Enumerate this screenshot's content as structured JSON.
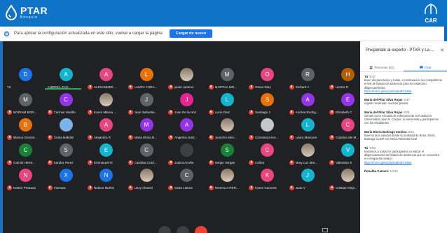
{
  "brand": {
    "name": "PTAR",
    "sub": "Bosquin",
    "right_logo": "CAR"
  },
  "notice": {
    "text": "Para aplicar la configuración actualizada en este sitio, vuelve a cargar la página",
    "button": "Cargar de nuevo"
  },
  "participants": [
    {
      "initial": "D",
      "color": "#1a73e8",
      "name": "Tú",
      "mic_off": false
    },
    {
      "initial": "A",
      "color": "#12b5cb",
      "name": "ANDREA PAO...",
      "mic_off": false
    },
    {
      "initial": "A",
      "color": "#e8467c",
      "name": "ALEXANDER ...",
      "mic_off": true
    },
    {
      "initial": "L",
      "color": "#e8710a",
      "name": "LAURA YURA...",
      "mic_off": true
    },
    {
      "initial": "",
      "color": "photo",
      "name": "javier ramirez",
      "mic_off": true
    },
    {
      "initial": "M",
      "color": "#5f6368",
      "name": "MARTHA MO...",
      "mic_off": true
    },
    {
      "initial": "O",
      "color": "#e8467c",
      "name": "Oscar Diaz",
      "mic_off": true
    },
    {
      "initial": "R",
      "color": "#5f6368",
      "name": "Richard A",
      "mic_off": true
    },
    {
      "initial": "H",
      "color": "#b06000",
      "name": "Hector R",
      "mic_off": true
    },
    {
      "initial": "M",
      "color": "#5f6368",
      "name": "MYRIAM BOR...",
      "mic_off": true
    },
    {
      "initial": "C",
      "color": "#9334e6",
      "name": "Carmen Murillo",
      "mic_off": true
    },
    {
      "initial": "",
      "color": "photo",
      "name": "Karen Milena ...",
      "mic_off": true
    },
    {
      "initial": "J",
      "color": "#5f6368",
      "name": "Juan Sebastia...",
      "mic_off": true
    },
    {
      "initial": "J",
      "color": "#e52592",
      "name": "Jose De la Hoz",
      "mic_off": true
    },
    {
      "initial": "L",
      "color": "#12b5cb",
      "name": "Lucio Diaz",
      "mic_off": true
    },
    {
      "initial": "S",
      "color": "#e8710a",
      "name": "Santiago J",
      "mic_off": true
    },
    {
      "initial": "A",
      "color": "#9334e6",
      "name": "Andrés Rodrig...",
      "mic_off": true
    },
    {
      "initial": "E",
      "color": "#9334e6",
      "name": "Elizabeth C",
      "mic_off": true
    },
    {
      "initial": "B",
      "color": "#e8710a",
      "name": "Blanca Gonzal...",
      "mic_off": true
    },
    {
      "initial": "",
      "color": "#7cb3e8",
      "name": "Gusta leididiel",
      "mic_off": true
    },
    {
      "initial": "A",
      "color": "#e8467c",
      "name": "Alejandra R",
      "mic_off": true
    },
    {
      "initial": "M",
      "color": "#9334e6",
      "name": "Maria Elvira B...",
      "mic_off": true
    },
    {
      "initial": "A",
      "color": "#9334e6",
      "name": "Angelica Garz...",
      "mic_off": true
    },
    {
      "initial": "",
      "color": "photo",
      "name": "Juancho Men...",
      "mic_off": true
    },
    {
      "initial": "",
      "color": "#c3c7cc",
      "name": "Constanza leo...",
      "mic_off": true
    },
    {
      "initial": "L",
      "color": "#12b5cb",
      "name": "Laura Mancera",
      "mic_off": true
    },
    {
      "initial": "C",
      "color": "#e8467c",
      "name": "Catalina del M...",
      "mic_off": true
    },
    {
      "initial": "C",
      "color": "#188038",
      "name": "Camilo Herra...",
      "mic_off": true
    },
    {
      "initial": "S",
      "color": "#5f6368",
      "name": "Sandra Perez",
      "mic_off": true
    },
    {
      "initial": "E",
      "color": "#12b5cb",
      "name": "Emmanuel N",
      "mic_off": true
    },
    {
      "initial": "C",
      "color": "#5f6368",
      "name": "Carolina Card...",
      "mic_off": true
    },
    {
      "initial": "",
      "color": "#3c4043",
      "name": "Josica Acuña",
      "mic_off": true
    },
    {
      "initial": "S",
      "color": "#188038",
      "name": "Sergio Vargas",
      "mic_off": true
    },
    {
      "initial": "C",
      "color": "#e8467c",
      "name": "Celina",
      "mic_off": true
    },
    {
      "initial": "",
      "color": "photo",
      "name": "Mary Luz Mor...",
      "mic_off": true
    },
    {
      "initial": "V",
      "color": "#12b5cb",
      "name": "Valentina S",
      "mic_off": true
    },
    {
      "initial": "N",
      "color": "#e8467c",
      "name": "Nestor Pedraza",
      "mic_off": true
    },
    {
      "initial": "X",
      "color": "#1a73e8",
      "name": "Xiomara",
      "mic_off": true
    },
    {
      "initial": "N",
      "color": "#1a73e8",
      "name": "Nelson Muñoz",
      "mic_off": true
    },
    {
      "initial": "",
      "color": "photo",
      "name": "Lizzy Alvarez",
      "mic_off": true
    },
    {
      "initial": "C",
      "color": "#5f6368",
      "name": "Clara Llanos",
      "mic_off": true
    },
    {
      "initial": "",
      "color": "photo",
      "name": "ROSALIA PER...",
      "mic_off": true
    },
    {
      "initial": "K",
      "color": "#e8467c",
      "name": "Karen Caceres",
      "mic_off": true
    },
    {
      "initial": "J",
      "color": "#12b5cb",
      "name": "Juan V",
      "mic_off": true
    },
    {
      "initial": "",
      "color": "photo",
      "name": "Cristian Aleja...",
      "mic_off": true
    }
  ],
  "panel": {
    "title": "Pregúntale al experto - PTAR y La ...",
    "tab_people": "Personas (51)",
    "tab_chat": "Chat",
    "messages": [
      {
        "author": "Tú",
        "time": "9:47",
        "body": "Buen día para todos y todas, a continuación les compartimos el link de listado de asistencia para su respectivo diligenciamiento:",
        "link": "https://forms.gle/ejtLebfoabuB7Jx9s6"
      },
      {
        "author": "Maria del Pilar Silva Rojas",
        "time": "9:47",
        "body": "registro realizado, muchas gracias",
        "link": ""
      },
      {
        "author": "Maria del Pilar Silva Rojas",
        "time": "9:51",
        "body": "Genial! como escuela de enfermeria de la Fundacion Universitaria Juan N. Corpas, la vienvenida y participamos con los estudiantes",
        "link": ""
      },
      {
        "author": "Maria Elvira Buitrago Insùina",
        "time": "9:51",
        "body": "Buenos días saludos desde la localidad de Bosa. Elvira Buitrago CLSIP CC Mesa Ambiental local",
        "link": ""
      },
      {
        "author": "Tú",
        "time": "9:53",
        "body": "Invitamos a todos los participantes a realizar el diligenciamiento del listado de asistencia que se encuentra en el siguiente enlace:",
        "link": "https://forms.gle/ejtLebfoabuB7Jx9s6"
      },
      {
        "author": "Rosalba Camero",
        "time": "10:03",
        "body": "",
        "link": ""
      }
    ]
  }
}
